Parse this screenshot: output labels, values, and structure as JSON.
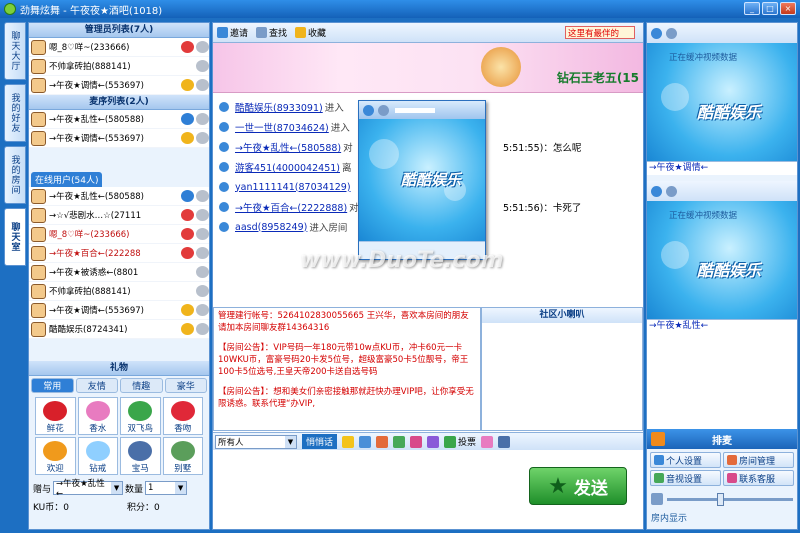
{
  "window": {
    "title": "劲舞炫舞 - 午夜夜★酒吧(1018)"
  },
  "side_tabs": [
    {
      "label": "聊天大厅"
    },
    {
      "label": "我的好友"
    },
    {
      "label": "我的房间"
    },
    {
      "label": "聊天室"
    }
  ],
  "admins": {
    "header": "管理员列表(7人)",
    "users": [
      {
        "name": "嗯_8♡咩~(233666)"
      },
      {
        "name": "不帅拿砖拍(888141)"
      },
      {
        "name": "→午夜★调情←(553697)"
      }
    ]
  },
  "mics": {
    "header": "麦序列表(2人)",
    "users": [
      {
        "name": "→午夜★乱性←(580588)"
      },
      {
        "name": "→午夜★调情←(553697)"
      }
    ]
  },
  "online": {
    "tab": "在线用户(54人)",
    "users": [
      {
        "name": "→午夜★乱性←(580588)"
      },
      {
        "name": "→☆√悲剧水…☆(27111"
      },
      {
        "name": "嗯_8♡咩~(233666)"
      },
      {
        "name": "→午夜★百合←(222288"
      },
      {
        "name": "→午夜★被诱惑←(8801"
      },
      {
        "name": "不帅拿砖拍(888141)"
      },
      {
        "name": "→午夜★调情←(553697)"
      },
      {
        "name": "酷酷娱乐(8724341)"
      }
    ]
  },
  "gifts": {
    "header": "礼物",
    "tabs": [
      "常用",
      "友情",
      "情趣",
      "豪华"
    ],
    "items": [
      {
        "label": "鲜花",
        "color": "#d8202a"
      },
      {
        "label": "香水",
        "color": "#e87bc0"
      },
      {
        "label": "双飞鸟",
        "color": "#3aa64a"
      },
      {
        "label": "香吻",
        "color": "#e02838"
      },
      {
        "label": "欢迎",
        "color": "#f09a1c"
      },
      {
        "label": "钻戒",
        "color": "#8fcfff"
      },
      {
        "label": "宝马",
        "color": "#4a6fa8"
      },
      {
        "label": "别墅",
        "color": "#5b9e5b"
      }
    ],
    "give_label": "赠与",
    "give_to": "→午夜★乱性←",
    "qty_label": "数量",
    "qty_value": "1",
    "ku_coin_label": "KU币：0",
    "points_label": "积分：0"
  },
  "toolbar": {
    "invite": "邀请",
    "find": "查找",
    "favorite": "收藏",
    "marquee": "这里有最伴的"
  },
  "banner": {
    "rank_text": "钻石王老五(15"
  },
  "chat": {
    "messages": [
      {
        "who": "酷酷娱乐(8933091)",
        "what": "进入",
        "tail": ""
      },
      {
        "who": "一世一世(87034624)",
        "what": "进入",
        "tail": ""
      },
      {
        "who": "→午夜★乱性←(580588)",
        "what": "对",
        "tail": "5:51:55)：怎么呢"
      },
      {
        "who": "游客451(4000042451)",
        "what": "离",
        "tail": ""
      },
      {
        "who": "yan1111141(87034129)",
        "what": "",
        "tail": ""
      },
      {
        "who": "→午夜★百合←(2222888)",
        "what": "对",
        "tail": "5:51:56)：卡死了"
      },
      {
        "who": "aasd(8958249)",
        "what": "进入房间",
        "tail": ""
      }
    ]
  },
  "notices": {
    "line1": "管理建行帐号：5264102830055665 王兴华，喜欢本房间的朋友请加本房间聊友群14364316",
    "line2": "【房间公告】：VIP号码一年180元带10w点KU币，冲卡60元一卡10WKU币，富豪号码20卡发5位号，超级富豪50卡5位靓号，帝王100卡5位选号,王皇天帝200卡送自选号码",
    "line3": "【房间公告】：想和美女们亲密接触那就赶快办理VIP吧，让你享受无限诱惑。联系代理“办VIP,"
  },
  "speaker": {
    "header": "社区小喇叭"
  },
  "input": {
    "target": "所有人",
    "whisper": "悄悄话",
    "vote": "投票",
    "send": "发送"
  },
  "video": {
    "brand": "酷酷娱乐",
    "note": "正在缓冲视频数据",
    "right1_user": "→午夜★调情←",
    "right2_user": "→午夜★乱性←"
  },
  "right_panel": {
    "rank_header": "排麦",
    "buttons": [
      "个人设置",
      "房间管理",
      "音视设置",
      "联系客服"
    ],
    "footer": "房内显示"
  },
  "watermark": "www.DuoTe.com"
}
